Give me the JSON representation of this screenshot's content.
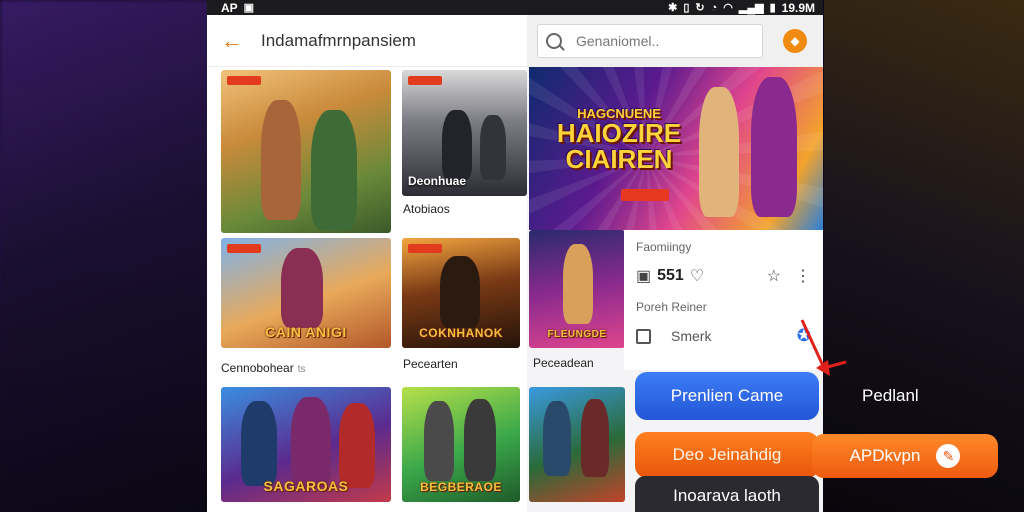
{
  "status_bar": {
    "left_text": "AP",
    "time": "19.9M"
  },
  "left_header": {
    "title": "Indamafmrnpansiem"
  },
  "grid": {
    "tiles": [
      {
        "caption": "",
        "logo": ""
      },
      {
        "caption": "Deonhuae",
        "logo": ""
      },
      {
        "caption": "",
        "logo": "CAIN ANIGI"
      },
      {
        "caption": "",
        "logo": "COKNHANOK"
      },
      {
        "caption": "",
        "logo": "SAGAROAS"
      },
      {
        "caption": "",
        "logo": "BEGBERAOE"
      }
    ],
    "labels": {
      "tile2_below": "Atobiaos",
      "row2_left": "Cennobohear",
      "row2_left_muted": "ts",
      "row2_mid": "Pecearten"
    }
  },
  "right_panel": {
    "search_placeholder": "Genaniomel..",
    "banner": {
      "title_small": "HAGCNUENE",
      "title_big": "HAIOZIRE CIAIREN"
    },
    "side_tile_logo": "FLEUNGDE",
    "side_label": "Peceadean",
    "info_card": {
      "label_top": "Faomiingy",
      "rating": "551",
      "label_mid": "Poreh Reiner",
      "checkbox_label": "Smerk"
    }
  },
  "buttons": {
    "primary": "Prenlien Came",
    "secondary": "Deo Jeinahdig",
    "tertiary": "Inoarava laoth",
    "download": "APDkvpn"
  },
  "outside_label": "Pedlanl",
  "colors": {
    "accent": "#f08a10",
    "primary_blue": "#2f67e6",
    "orange": "#f06a14",
    "dark": "#2a2a30"
  }
}
